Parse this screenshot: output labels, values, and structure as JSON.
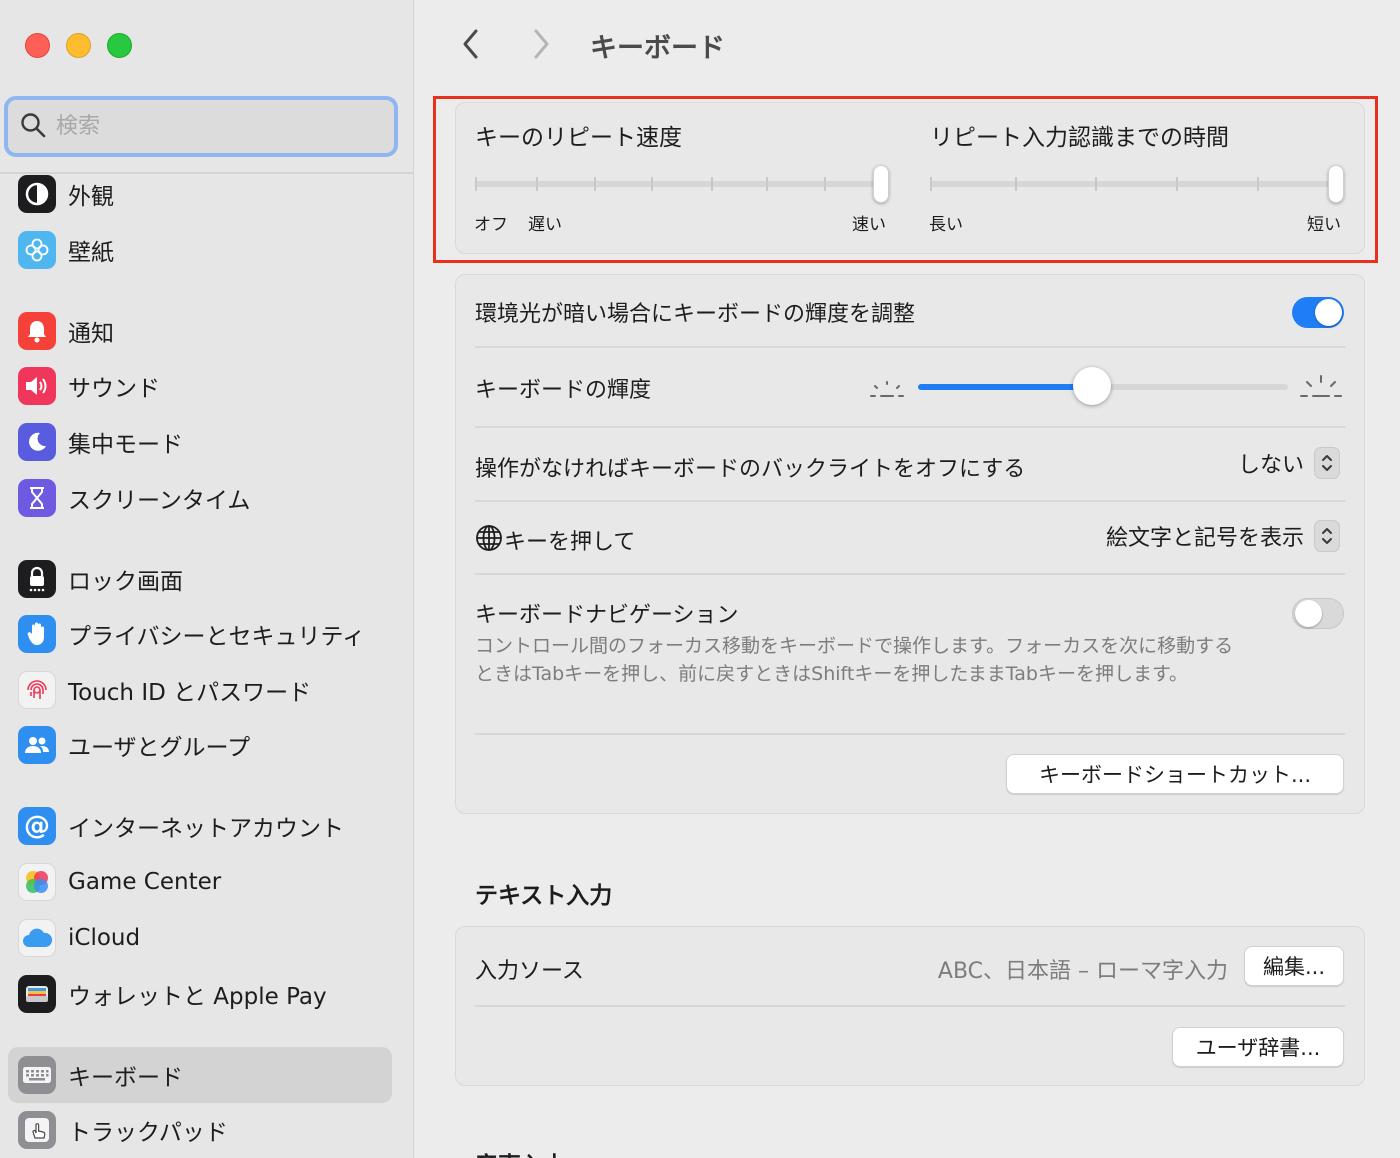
{
  "window": {
    "title": "キーボード"
  },
  "search": {
    "placeholder": "検索"
  },
  "sidebar": {
    "items": [
      {
        "label": "外観",
        "icon": "appearance-icon",
        "color": "#1d1d1f"
      },
      {
        "label": "壁紙",
        "icon": "wallpaper-icon",
        "color": "#4fb6f0"
      },
      {
        "label": "通知",
        "icon": "bell-icon",
        "color": "#f5413a"
      },
      {
        "label": "サウンド",
        "icon": "speaker-icon",
        "color": "#f0365a"
      },
      {
        "label": "集中モード",
        "icon": "moon-icon",
        "color": "#5a5ce0"
      },
      {
        "label": "スクリーンタイム",
        "icon": "hourglass-icon",
        "color": "#6e5ae0"
      },
      {
        "label": "ロック画面",
        "icon": "lock-icon",
        "color": "#1d1d1f"
      },
      {
        "label": "プライバシーとセキュリティ",
        "icon": "hand-icon",
        "color": "#2f8ff0"
      },
      {
        "label": "Touch ID とパスワード",
        "icon": "fingerprint-icon",
        "color": "#f2f2f2"
      },
      {
        "label": "ユーザとグループ",
        "icon": "users-icon",
        "color": "#2f8ff0"
      },
      {
        "label": "インターネットアカウント",
        "icon": "at-icon",
        "color": "#2f8ff0"
      },
      {
        "label": "Game Center",
        "icon": "game-center-icon",
        "color": "#f2f2f2"
      },
      {
        "label": "iCloud",
        "icon": "cloud-icon",
        "color": "#f2f2f2"
      },
      {
        "label": "ウォレットと Apple Pay",
        "icon": "wallet-icon",
        "color": "#1d1d1f"
      },
      {
        "label": "キーボード",
        "icon": "keyboard-icon",
        "color": "#8e8e93",
        "selected": true
      },
      {
        "label": "トラックパッド",
        "icon": "trackpad-icon",
        "color": "#8e8e93"
      }
    ]
  },
  "repeat": {
    "rate_title": "キーのリピート速度",
    "rate_off": "オフ",
    "rate_slow": "遅い",
    "rate_fast": "速い",
    "rate_value": 1.0,
    "delay_title": "リピート入力認識までの時間",
    "delay_long": "長い",
    "delay_short": "短い",
    "delay_value": 1.0
  },
  "backlight": {
    "auto_label": "環境光が暗い場合にキーボードの輝度を調整",
    "auto_on": true,
    "brightness_label": "キーボードの輝度",
    "brightness_value": 0.47,
    "off_label": "操作がなければキーボードのバックライトをオフにする",
    "off_value": "しない"
  },
  "globe": {
    "label": "キーを押して",
    "value": "絵文字と記号を表示"
  },
  "navigation": {
    "label": "キーボードナビゲーション",
    "on": false,
    "description": "コントロール間のフォーカス移動をキーボードで操作します。フォーカスを次に移動するときはTabキーを押し、前に戻すときはShiftキーを押したままTabキーを押します。"
  },
  "shortcuts_button": "キーボードショートカット...",
  "text_input": {
    "section_title": "テキスト入力",
    "sources_label": "入力ソース",
    "sources_value": "ABC、日本語 – ローマ字入力",
    "edit_button": "編集...",
    "dictionary_button": "ユーザ辞書..."
  },
  "next_section_title": "音声入力"
}
